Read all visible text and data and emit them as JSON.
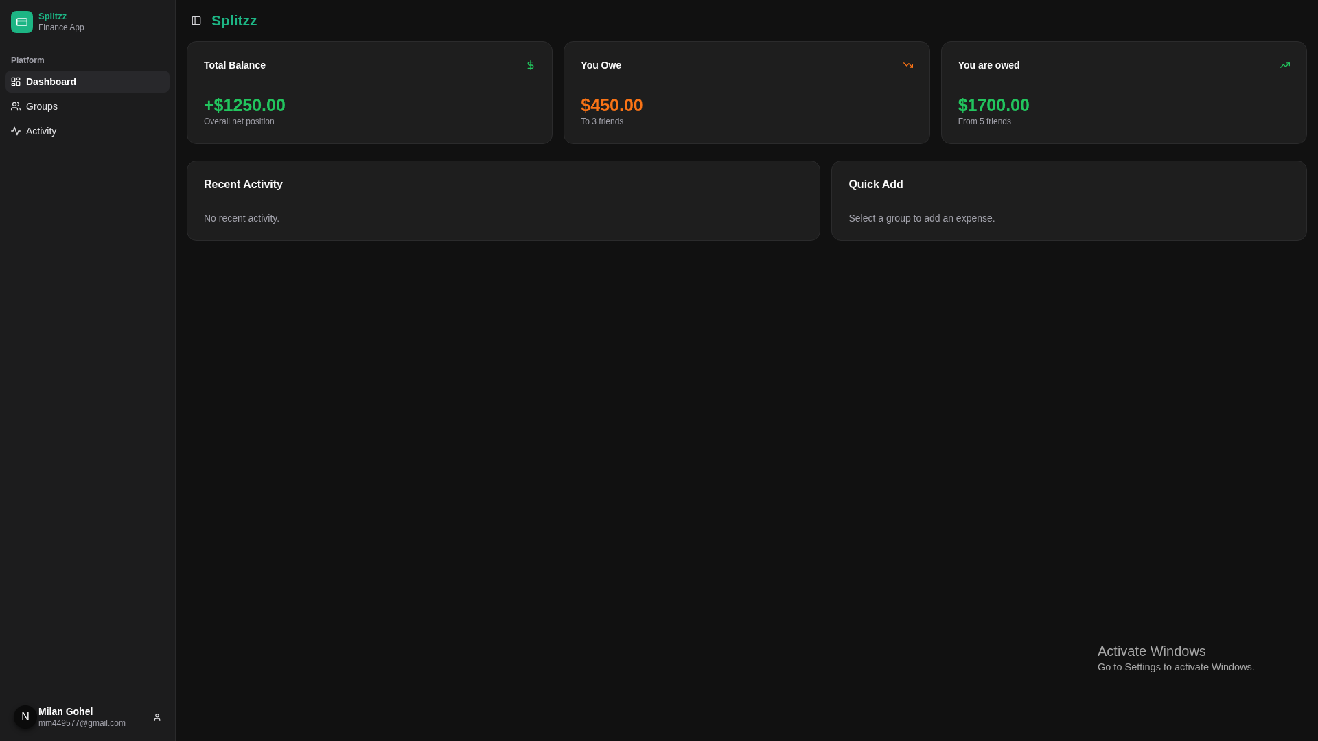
{
  "sidebar": {
    "brand": {
      "name": "Splitzz",
      "subtitle": "Finance App"
    },
    "section_label": "Platform",
    "items": [
      {
        "label": "Dashboard",
        "selected": true
      },
      {
        "label": "Groups",
        "selected": false
      },
      {
        "label": "Activity",
        "selected": false
      }
    ],
    "user": {
      "avatar": "N",
      "name": "Milan Gohel",
      "email": "mm449577@gmail.com"
    }
  },
  "header": {
    "title": "Splitzz"
  },
  "stat_cards": [
    {
      "title": "Total Balance",
      "value": "+$1250.00",
      "caption": "Overall net position",
      "color": "#22c55e"
    },
    {
      "title": "You Owe",
      "value": "$450.00",
      "caption": "To 3 friends",
      "color": "#f97316"
    },
    {
      "title": "You are owed",
      "value": "$1700.00",
      "caption": "From 5 friends",
      "color": "#22c55e"
    }
  ],
  "panels": [
    {
      "title": "Recent Activity",
      "text": "No recent activity."
    },
    {
      "title": "Quick Add",
      "text": "Select a group to add an expense."
    }
  ],
  "os_notice": {
    "title": "Activate Windows",
    "text": "Go to Settings to activate Windows."
  }
}
